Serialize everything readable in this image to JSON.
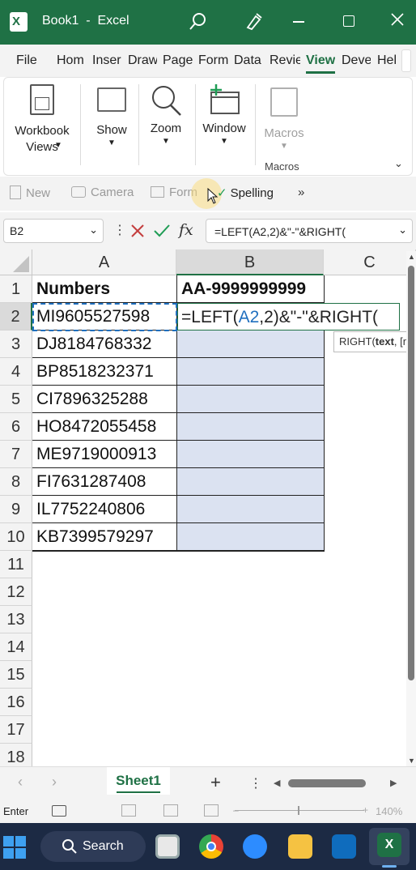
{
  "titlebar": {
    "title": "Book1  -  Excel"
  },
  "tabs": [
    "File",
    "Hom",
    "Inser",
    "Draw",
    "Page",
    "Form",
    "Data",
    "Revie",
    "View",
    "Deve",
    "Hel"
  ],
  "ribbon": {
    "workbook_views": "Workbook Views",
    "show": "Show",
    "zoom": "Zoom",
    "window": "Window",
    "macros": "Macros",
    "macros_group": "Macros"
  },
  "qat": {
    "new": "New",
    "camera": "Camera",
    "form": "Form",
    "spelling": "Spelling",
    "more": "»"
  },
  "formula_bar": {
    "name_box": "B2",
    "fx": "fx",
    "formula": "=LEFT(A2,2)&\"-\"&RIGHT("
  },
  "grid": {
    "columns": [
      "A",
      "B",
      "C"
    ],
    "rows": [
      "1",
      "2",
      "3",
      "4",
      "5",
      "6",
      "7",
      "8",
      "9",
      "10",
      "11",
      "12",
      "13",
      "14",
      "15",
      "16",
      "17",
      "18"
    ],
    "A": [
      "Numbers",
      "MI9605527598",
      "DJ8184768332",
      "BP8518232371",
      "CI7896325288",
      "HO8472055458",
      "ME9719000913",
      "FI7631287408",
      "IL7752240806",
      "KB7399579297"
    ],
    "B1": "AA-9999999999",
    "edit": {
      "p1": "=LEFT(",
      "ref": "A2",
      "p2": ",2)&\"-\"&RIGHT("
    },
    "tooltip": {
      "fn": "RIGHT(",
      "arg": "text",
      ", [n": ", [n"
    }
  },
  "sheets": {
    "active": "Sheet1",
    "add": "+"
  },
  "status": {
    "mode": "Enter",
    "zoom": "140%"
  },
  "taskbar": {
    "search": "Search"
  },
  "colors": {
    "excel_green": "#1f7145",
    "selection": "#dbe2f1",
    "ref_blue": "#1f6fbf"
  }
}
